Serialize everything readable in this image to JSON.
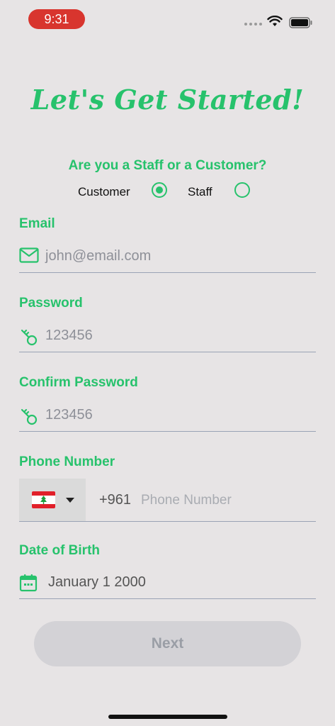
{
  "status_bar": {
    "time": "9:31"
  },
  "title": "Let's Get Started!",
  "role": {
    "question": "Are you a Staff or a Customer?",
    "options": [
      {
        "label": "Customer",
        "selected": true
      },
      {
        "label": "Staff",
        "selected": false
      }
    ]
  },
  "fields": {
    "email": {
      "label": "Email",
      "placeholder": "john@email.com",
      "icon": "mail-icon"
    },
    "password": {
      "label": "Password",
      "placeholder": "123456",
      "icon": "key-icon"
    },
    "confirm_password": {
      "label": "Confirm Password",
      "placeholder": "123456",
      "icon": "key-icon"
    },
    "phone": {
      "label": "Phone Number",
      "country_flag": "lebanon-flag",
      "dial_code": "+961",
      "placeholder": "Phone Number"
    },
    "dob": {
      "label": "Date of Birth",
      "value": "January 1 2000",
      "icon": "calendar-icon"
    }
  },
  "next_button": {
    "label": "Next"
  },
  "colors": {
    "accent": "#27C26C",
    "background": "#E7E4E5",
    "time_pill": "#D8352E",
    "button_disabled": "#D3D2D6",
    "divider": "#9AA3B5"
  }
}
